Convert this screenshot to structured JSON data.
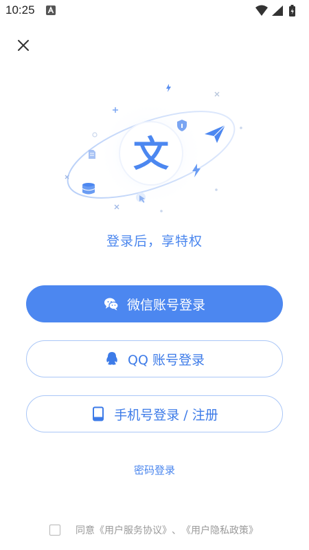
{
  "status_bar": {
    "time": "10:25",
    "icons": [
      "notification-a-icon",
      "wifi-icon",
      "cellular-icon",
      "battery-icon"
    ]
  },
  "close_icon": "close-icon",
  "hero": {
    "center_glyph": "文",
    "accent_color": "#4c87f0",
    "icons": [
      "flash-icon",
      "shield-icon",
      "paper-plane-icon",
      "document-icon",
      "database-icon",
      "pointer-icon",
      "plus-icon",
      "cross-icon"
    ]
  },
  "tagline": "登录后，享特权",
  "buttons": {
    "wechat": {
      "label": "微信账号登录",
      "icon": "wechat-icon"
    },
    "qq": {
      "label": "QQ 账号登录",
      "icon": "qq-icon"
    },
    "phone": {
      "label": "手机号登录 / 注册",
      "icon": "phone-icon"
    }
  },
  "password_login": "密码登录",
  "agreement": {
    "prefix": "同意",
    "user_agreement": "《用户服务协议》",
    "separator": "、",
    "privacy_policy": "《用户隐私政策》",
    "checked": false
  },
  "colors": {
    "primary": "#4c87f0",
    "outline": "#a9c6f7",
    "link": "#4a86ee"
  }
}
